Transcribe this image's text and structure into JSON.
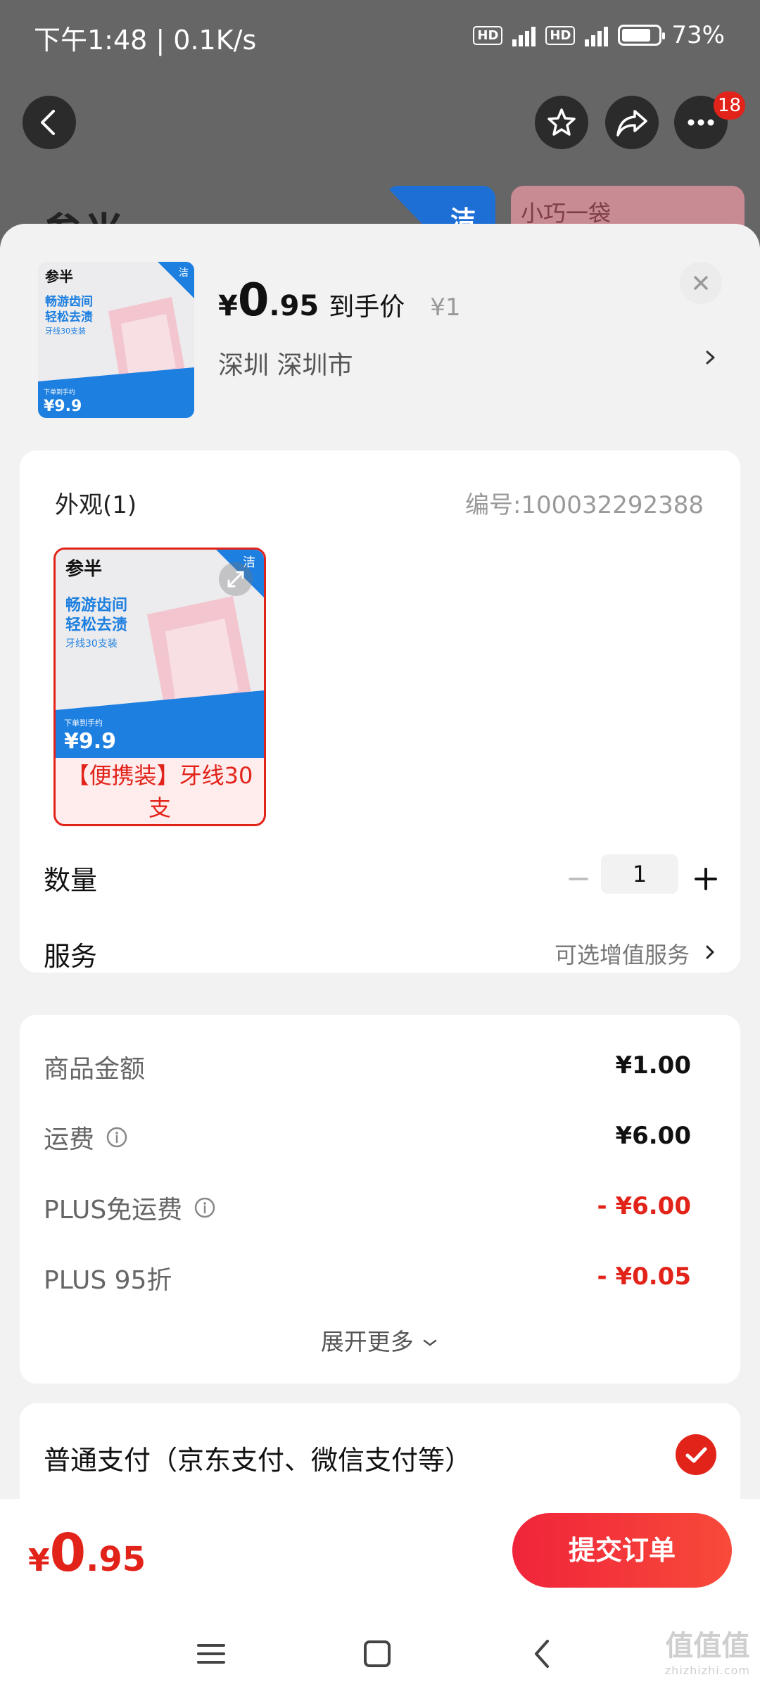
{
  "status_bar": {
    "time_speed": "下午1:48 | 0.1K/s",
    "hd": "HD",
    "net": "4G",
    "battery": "73%"
  },
  "background": {
    "title": "参半",
    "tag_blue": "洁",
    "tag_pink": "小巧一袋",
    "badge_count": "18"
  },
  "header": {
    "yuan": "¥",
    "price_int": "0",
    "price_dec": ".95",
    "price_label": "到手价",
    "orig_price": "¥1",
    "address": "深圳  深圳市"
  },
  "thumb": {
    "brand": "参半",
    "corner": "洁",
    "line1": "畅游齿间",
    "line2": "轻松去渍",
    "line3": "牙线30支装",
    "promo_small": "下单到手约",
    "promo_price": "¥9.9"
  },
  "spec": {
    "label": "外观(1)",
    "code": "编号:100032292388",
    "option_text": "【便携装】牙线30支"
  },
  "quantity": {
    "label": "数量",
    "value": "1"
  },
  "service": {
    "label": "服务",
    "value": "可选增值服务"
  },
  "fees": [
    {
      "label": "商品金额",
      "value": "¥1.00",
      "info": false,
      "red": false
    },
    {
      "label": "运费",
      "value": "¥6.00",
      "info": true,
      "red": false
    },
    {
      "label": "PLUS免运费",
      "value": "- ¥6.00",
      "info": true,
      "red": true
    },
    {
      "label": "PLUS 95折",
      "value": "- ¥0.05",
      "info": false,
      "red": true
    }
  ],
  "expand_more": "展开更多",
  "payment": {
    "label": "普通支付（京东支付、微信支付等）"
  },
  "bottom": {
    "yuan": "¥",
    "total_int": "0",
    "total_dec": ".95",
    "submit": "提交订单"
  },
  "watermark": {
    "main": "值值值",
    "sub": "zhizhizhi.com"
  },
  "colors": {
    "accent": "#e2231a",
    "blue": "#1d6fd6"
  }
}
